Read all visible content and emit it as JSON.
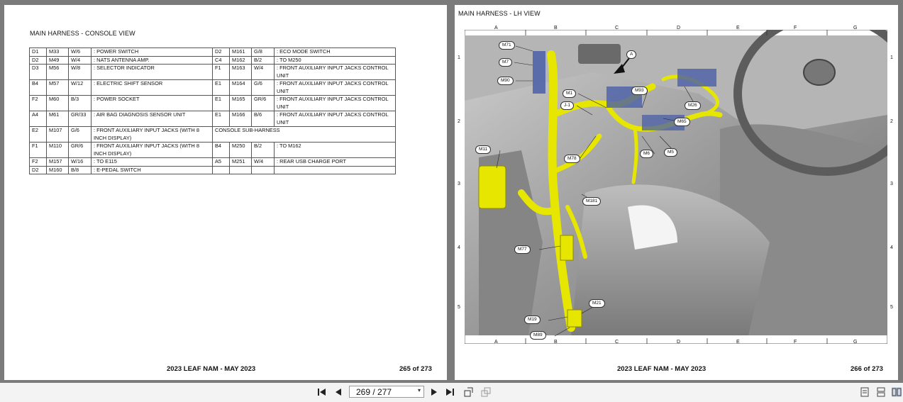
{
  "left_page": {
    "title": "MAIN HARNESS - CONSOLE VIEW",
    "footer_title": "2023 LEAF NAM - MAY 2023",
    "footer_page": "265 of 273",
    "table_rows": [
      {
        "l": [
          "D1",
          "M33",
          "W/6",
          ": POWER SWITCH"
        ],
        "r": [
          "D2",
          "M161",
          "G/8",
          ": ECO MODE SWITCH"
        ]
      },
      {
        "l": [
          "D2",
          "M49",
          "W/4",
          ": NATS ANTENNA AMP."
        ],
        "r": [
          "C4",
          "M162",
          "B/2",
          ": TO M250"
        ]
      },
      {
        "l": [
          "D3",
          "M56",
          "W/8",
          ": SELECTOR INDICATOR"
        ],
        "r": [
          "F1",
          "M163",
          "W/4",
          ": FRONT AUXILIARY INPUT JACKS CONTROL UNIT"
        ]
      },
      {
        "l": [
          "B4",
          "M57",
          "W/12",
          ": ELECTRIC SHIFT SENSOR"
        ],
        "r": [
          "E1",
          "M164",
          "G/6",
          ": FRONT AUXILIARY INPUT JACKS CONTROL UNIT"
        ]
      },
      {
        "l": [
          "F2",
          "M60",
          "B/3",
          ": POWER SOCKET"
        ],
        "r": [
          "E1",
          "M165",
          "GR/6",
          ": FRONT AUXILIARY INPUT JACKS CONTROL UNIT"
        ]
      },
      {
        "l": [
          "A4",
          "M61",
          "GR/33",
          ": AIR BAG DIAGNOSIS SENSOR UNIT"
        ],
        "r": [
          "E1",
          "M166",
          "B/6",
          ": FRONT AUXILIARY INPUT JACKS CONTROL UNIT"
        ]
      },
      {
        "l": [
          "E2",
          "M107",
          "G/6",
          ": FRONT AUXILIARY INPUT JACKS (WITH 8 INCH DISPLAY)"
        ],
        "r_header": "CONSOLE SUB-HARNESS"
      },
      {
        "l": [
          "F1",
          "M110",
          "GR/6",
          ": FRONT AUXILIARY INPUT JACKS (WITH 8 INCH DISPLAY)"
        ],
        "r": [
          "B4",
          "M250",
          "B/2",
          ": TO M162"
        ]
      },
      {
        "l": [
          "F2",
          "M157",
          "W/16",
          ": TO E115"
        ],
        "r": [
          "A5",
          "M251",
          "W/4",
          ": REAR USB CHARGE PORT"
        ]
      },
      {
        "l": [
          "D2",
          "M160",
          "B/8",
          ": E-PEDAL SWITCH"
        ],
        "r": [
          "",
          "",
          "",
          ""
        ]
      }
    ]
  },
  "right_page": {
    "title": "MAIN HARNESS - LH VIEW",
    "footer_title": "2023 LEAF NAM - MAY 2023",
    "footer_page": "266 of 273",
    "grid_cols": [
      "A",
      "B",
      "C",
      "D",
      "E",
      "F",
      "G"
    ],
    "grid_rows": [
      "1",
      "2",
      "3",
      "4",
      "5"
    ],
    "callouts": [
      "M71",
      "M7",
      "M90",
      "M1",
      "J-1",
      "M93",
      "A",
      "M26",
      "M65",
      "M6",
      "M5",
      "M11",
      "M78",
      "M181",
      "M77",
      "M21",
      "M19",
      "M89"
    ]
  },
  "toolbar": {
    "page_indicator": "269 / 277",
    "icons": [
      "first-page-icon",
      "prev-page-icon",
      "next-page-icon",
      "last-page-icon",
      "rotate-icon",
      "export-icon",
      "single-page-icon",
      "continuous-icon",
      "two-page-icon"
    ]
  },
  "colors": {
    "background": "#7b7b7b",
    "harness": "#e6e600",
    "connector": "#4a5fa8",
    "toolbar": "#f3f3f3"
  }
}
